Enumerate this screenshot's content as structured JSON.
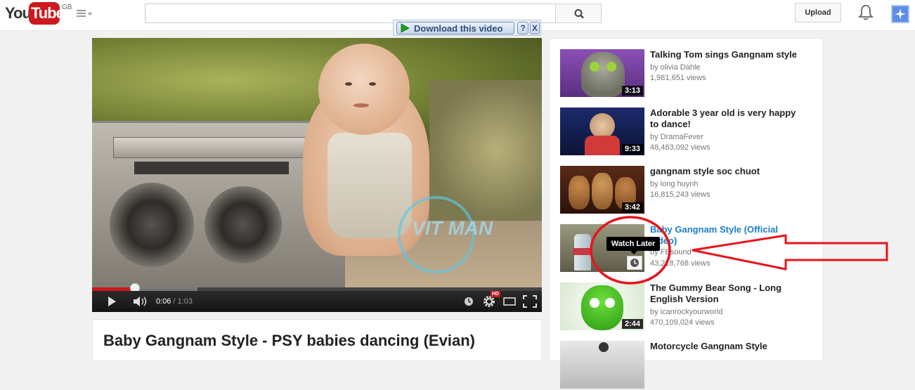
{
  "header": {
    "logo_you": "You",
    "logo_tube": "Tube",
    "logo_region": "GB",
    "search_placeholder": "",
    "upload_label": "Upload"
  },
  "download_bar": {
    "label": "Download this video",
    "help": "?",
    "close": "X"
  },
  "player": {
    "watermark": "VIT MAN",
    "current_time": "0:06",
    "separator": " / ",
    "duration": "1:03",
    "hd_badge": "HD",
    "progress_played": 0.095
  },
  "video": {
    "title": "Baby Gangnam Style - PSY babies dancing (Evian)"
  },
  "related": [
    {
      "title": "Talking Tom sings Gangnam style",
      "channel": "by olivia Dahle",
      "views": "1,981,651 views",
      "duration": "3:13",
      "thumb": "tom"
    },
    {
      "title": "Adorable 3 year old is very happy to dance!",
      "channel": "by DramaFever",
      "views": "48,483,092 views",
      "duration": "9:33",
      "thumb": "stage"
    },
    {
      "title": "gangnam style soc chuot",
      "channel": "by long huynh",
      "views": "16,815,243 views",
      "duration": "3:42",
      "thumb": "chipmunks"
    },
    {
      "title": "Baby Gangnam Style (Official video)",
      "channel": "by FBsound",
      "views": "43,218,768 views",
      "duration": "",
      "thumb": "baby",
      "active": true
    },
    {
      "title": "The Gummy Bear Song - Long English Version",
      "channel": "by icanrockyourworld",
      "views": "470,109,024 views",
      "duration": "2:44",
      "thumb": "gummy"
    },
    {
      "title": "Motorcycle Gangnam Style",
      "channel": "",
      "views": "",
      "duration": "",
      "thumb": "moto"
    }
  ],
  "tooltip": {
    "label": "Watch Later"
  },
  "colors": {
    "brand_red": "#cc181e",
    "annotation_red": "#e8141c",
    "active_link": "#1b7fcc"
  }
}
